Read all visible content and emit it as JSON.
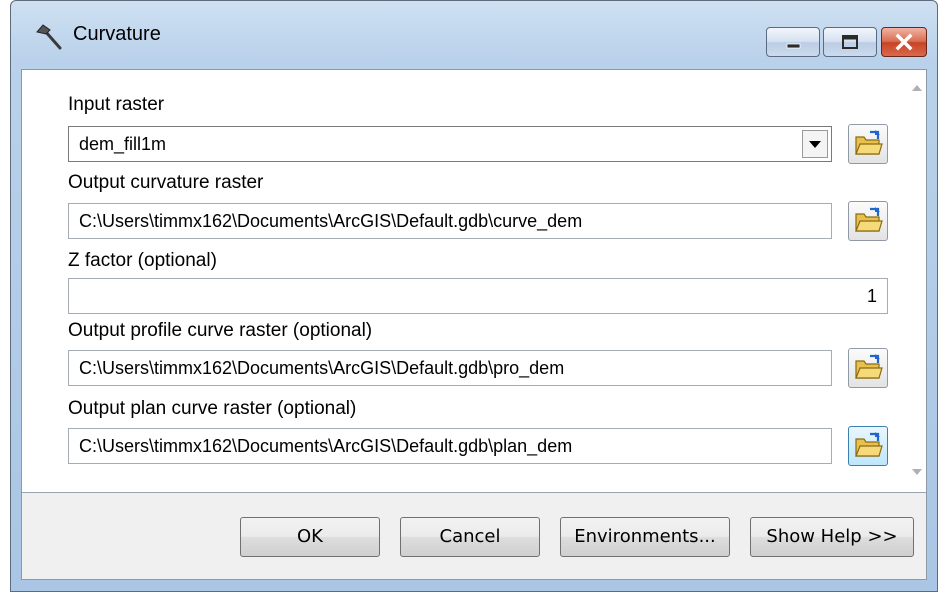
{
  "window": {
    "title": "Curvature",
    "icon": "hammer-icon"
  },
  "params": {
    "input_raster": {
      "label": "Input raster",
      "value": "dem_fill1m"
    },
    "output_curvature": {
      "label": "Output curvature raster",
      "value": "C:\\Users\\timmx162\\Documents\\ArcGIS\\Default.gdb\\curve_dem"
    },
    "z_factor": {
      "label": "Z factor (optional)",
      "value": "1"
    },
    "output_profile": {
      "label": "Output profile curve raster (optional)",
      "value": "C:\\Users\\timmx162\\Documents\\ArcGIS\\Default.gdb\\pro_dem"
    },
    "output_plan": {
      "label": "Output plan curve raster (optional)",
      "value": "C:\\Users\\timmx162\\Documents\\ArcGIS\\Default.gdb\\plan_dem"
    }
  },
  "buttons": {
    "ok": "OK",
    "cancel": "Cancel",
    "environments": "Environments...",
    "show_help": "Show Help >>"
  }
}
